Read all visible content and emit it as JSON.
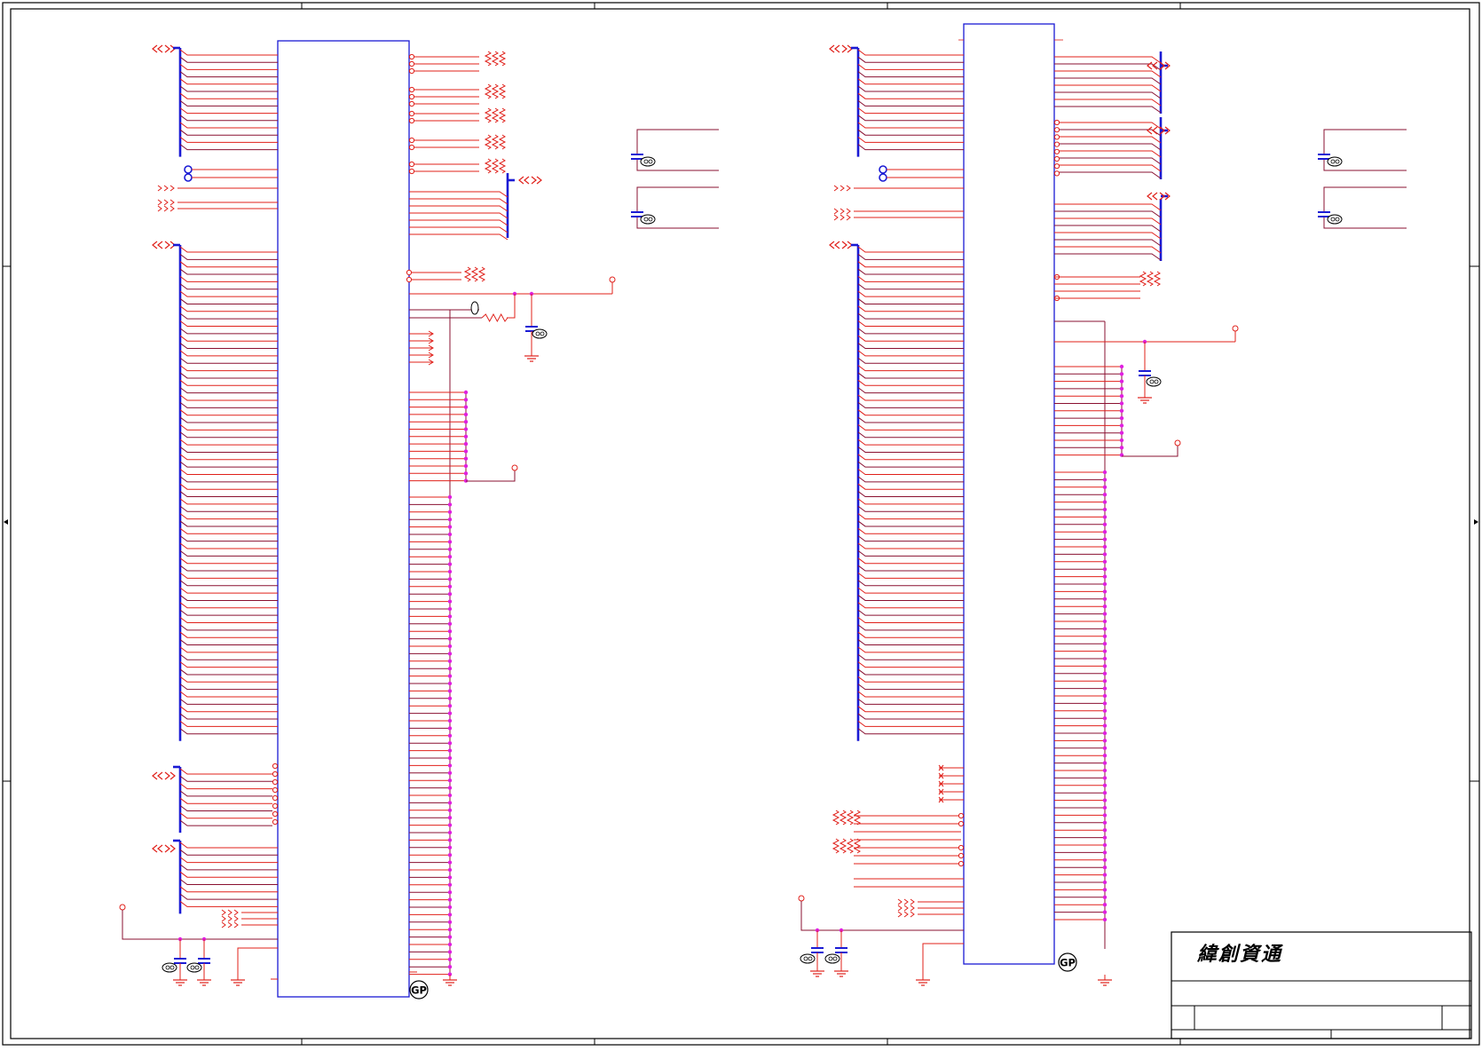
{
  "title_block": {
    "company": "緯創資通"
  },
  "badges": {
    "gp": "GP"
  },
  "colors": {
    "frame": "#000000",
    "chip": "#1a1ad4",
    "bus": "#1a1ad4",
    "net": "#e0201a",
    "wire_alt": "#8a1030",
    "junction": "#e020e0",
    "cap": "#1a1ad4",
    "ground": "#e0201a",
    "badge": "#000000"
  },
  "sheet": {
    "zones": 4
  }
}
